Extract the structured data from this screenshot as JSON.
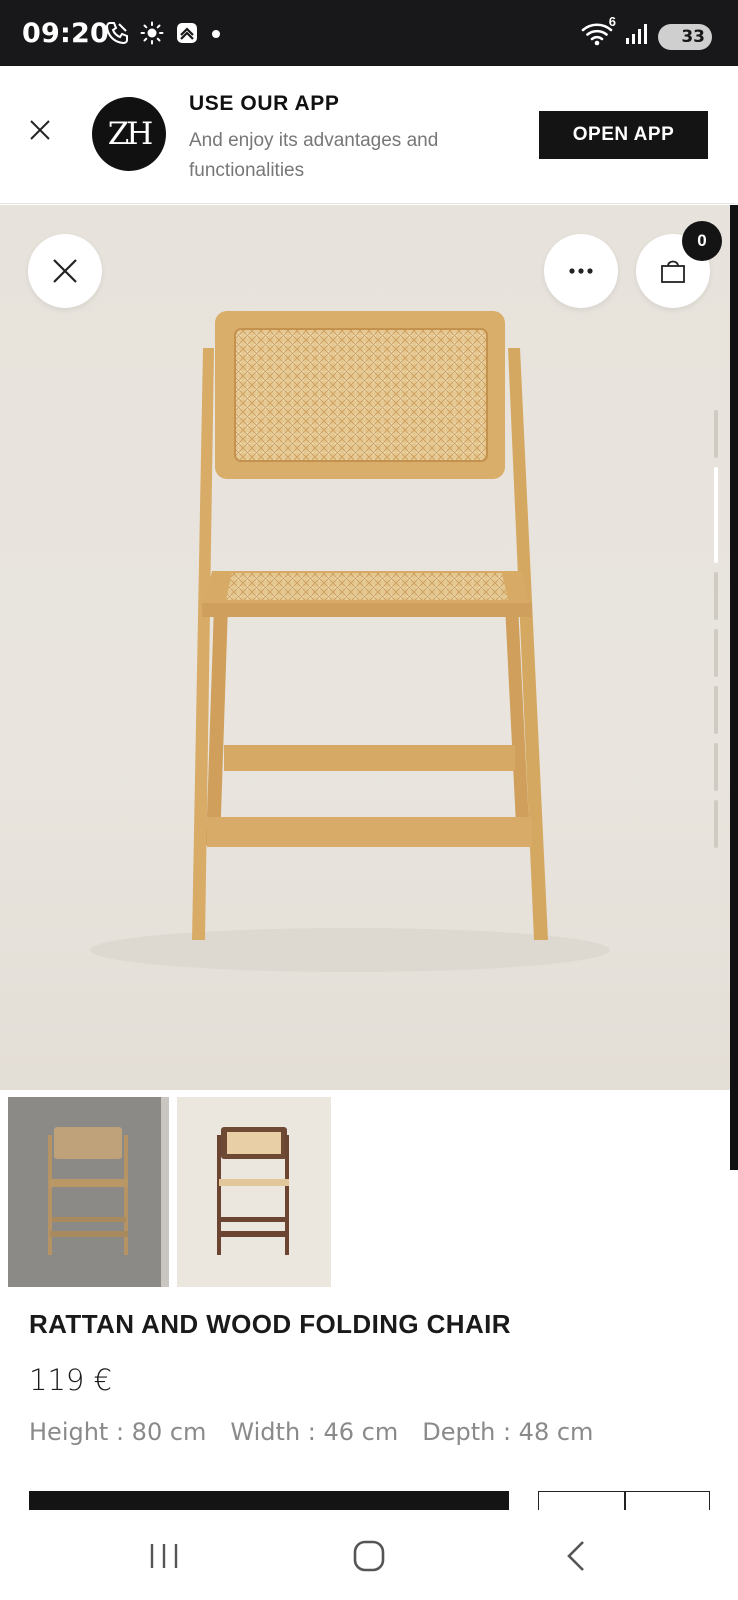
{
  "status_bar": {
    "time": "09:20",
    "network_badge": "6",
    "battery": "33",
    "icons_left": [
      "phone-call-icon",
      "brightness-icon",
      "app-notification-icon",
      "dot-icon"
    ],
    "icons_right": [
      "wifi-icon",
      "signal-icon",
      "battery-icon"
    ]
  },
  "app_banner": {
    "logo_text": "ZH",
    "title": "USE OUR APP",
    "subtitle": "And enjoy its advantages and functionalities",
    "cta_label": "OPEN APP"
  },
  "gallery": {
    "cart_count": "0",
    "image_count": 8,
    "active_image_index": 2
  },
  "product": {
    "name": "RATTAN AND WOOD FOLDING CHAIR",
    "price": "119 €",
    "dimensions": {
      "height": "Height : 80 cm",
      "width": "Width : 46 cm",
      "depth": "Depth : 48 cm"
    }
  },
  "colors": {
    "dark": "#141414",
    "background": "#e7e3dc",
    "wood": "#d9ae6b",
    "rattan": "#e3c48f"
  }
}
